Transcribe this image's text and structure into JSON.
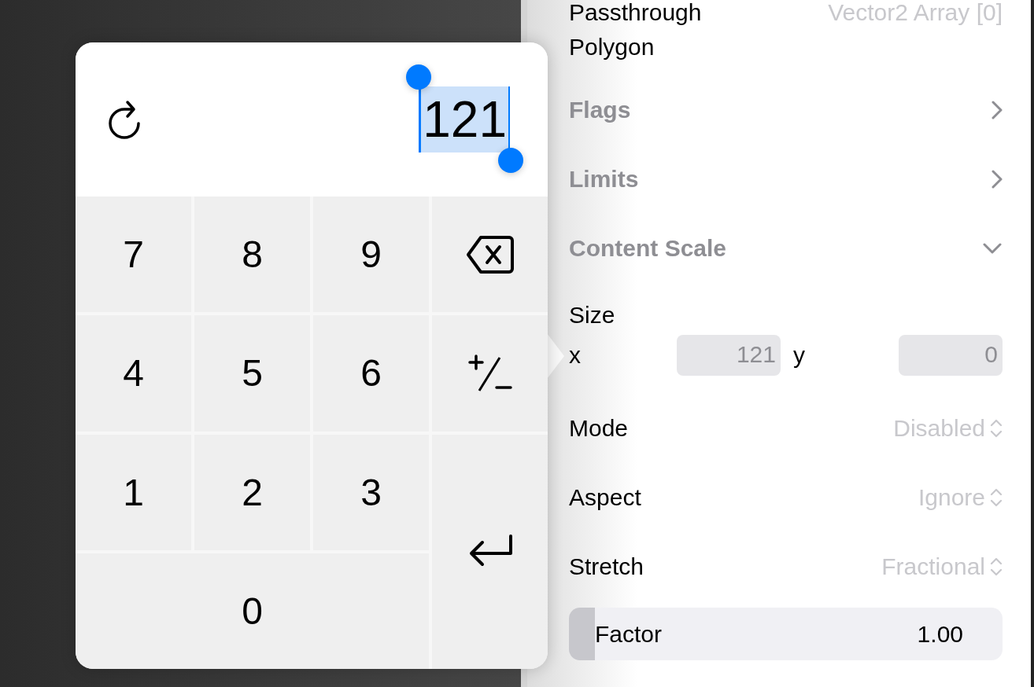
{
  "inspector": {
    "top_row": {
      "label": "Passthrough Polygon",
      "value": "Vector2 Array [0]"
    },
    "sections": [
      {
        "title": "Flags",
        "expanded": false
      },
      {
        "title": "Limits",
        "expanded": false
      },
      {
        "title": "Content Scale",
        "expanded": true
      }
    ],
    "size": {
      "label": "Size",
      "x_label": "x",
      "x_value": "121",
      "y_label": "y",
      "y_value": "0"
    },
    "options": [
      {
        "label": "Mode",
        "value": "Disabled"
      },
      {
        "label": "Aspect",
        "value": "Ignore"
      },
      {
        "label": "Stretch",
        "value": "Fractional"
      }
    ],
    "factor": {
      "label": "Factor",
      "value": "1.00",
      "level": 0.06
    }
  },
  "keypad": {
    "value": "121",
    "value_selected": true,
    "keys": [
      {
        "kind": "digit",
        "label": "7"
      },
      {
        "kind": "digit",
        "label": "8"
      },
      {
        "kind": "digit",
        "label": "9"
      },
      {
        "kind": "backspace"
      },
      {
        "kind": "digit",
        "label": "4"
      },
      {
        "kind": "digit",
        "label": "5"
      },
      {
        "kind": "digit",
        "label": "6"
      },
      {
        "kind": "sign"
      },
      {
        "kind": "digit",
        "label": "1"
      },
      {
        "kind": "digit",
        "label": "2"
      },
      {
        "kind": "digit",
        "label": "3"
      },
      {
        "kind": "enter"
      },
      {
        "kind": "digit",
        "label": "0",
        "wide": true
      }
    ]
  }
}
